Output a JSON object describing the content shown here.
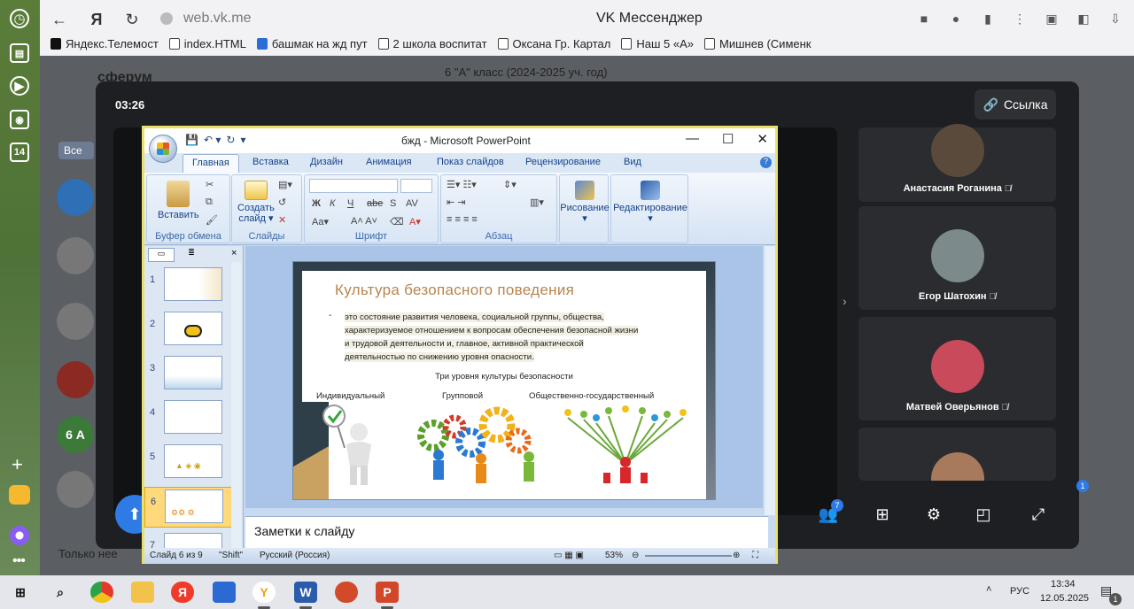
{
  "browser": {
    "url": "web.vk.me",
    "page_title": "VK Мессенджер",
    "bookmarks": [
      "Яндекс.Телемост",
      "index.HTML",
      "башмак на жд пут",
      "2 школа воспитат",
      "Оксана Гр. Картал",
      "Наш 5 «А»",
      "Мишнев (Сименк"
    ]
  },
  "os_sidebar": {
    "calendar_day": "14"
  },
  "vk": {
    "logo": "сферум",
    "chat_title": "6 \"А\" класс (2024-2025 уч. год)",
    "filter_label": "Все",
    "footer_text": "Только нее",
    "avatar_label": "6 А"
  },
  "call": {
    "timer": "03:26",
    "link_button": "Ссылка",
    "participants": [
      {
        "name": "Анастасия Роганина"
      },
      {
        "name": "Егор Шатохин"
      },
      {
        "name": "Матвей Оверьянов"
      },
      {
        "name": ""
      }
    ],
    "participants_badge": "7",
    "side_badge": "1"
  },
  "ppt": {
    "window_title": "бжд - Microsoft PowerPoint",
    "tabs": [
      "Главная",
      "Вставка",
      "Дизайн",
      "Анимация",
      "Показ слайдов",
      "Рецензирование",
      "Вид"
    ],
    "groups": {
      "clipboard": "Буфер обмена",
      "slides": "Слайды",
      "font": "Шрифт",
      "paragraph": "Абзац"
    },
    "buttons": {
      "paste": "Вставить",
      "new_slide_1": "Создать",
      "new_slide_2": "слайд ▾",
      "drawing": "Рисование",
      "editing": "Редактирование"
    },
    "slide_numbers": [
      "1",
      "2",
      "3",
      "4",
      "5",
      "6",
      "7"
    ],
    "slide": {
      "title": "Культура безопасного поведения",
      "bullet": "-",
      "body_lines": [
        "это состояние развития человека, социальной группы, общества,",
        "характеризуемое отношением к вопросам обеспечения безопасной жизни",
        "и трудовой деятельности и, главное, активной практической",
        "деятельностью по снижению уровня опасности."
      ],
      "subtitle": "Три уровня культуры безопасности",
      "columns": [
        "Индивидуальный",
        "Групповой",
        "Общественно-государственный"
      ]
    },
    "notes": "Заметки к слайду",
    "status": {
      "slide": "Слайд 6 из 9",
      "theme": "\"Shift\"",
      "language": "Русский (Россия)",
      "zoom": "53%"
    }
  },
  "taskbar": {
    "lang": "РУС",
    "time": "13:34",
    "date": "12.05.2025",
    "notif": "1"
  }
}
